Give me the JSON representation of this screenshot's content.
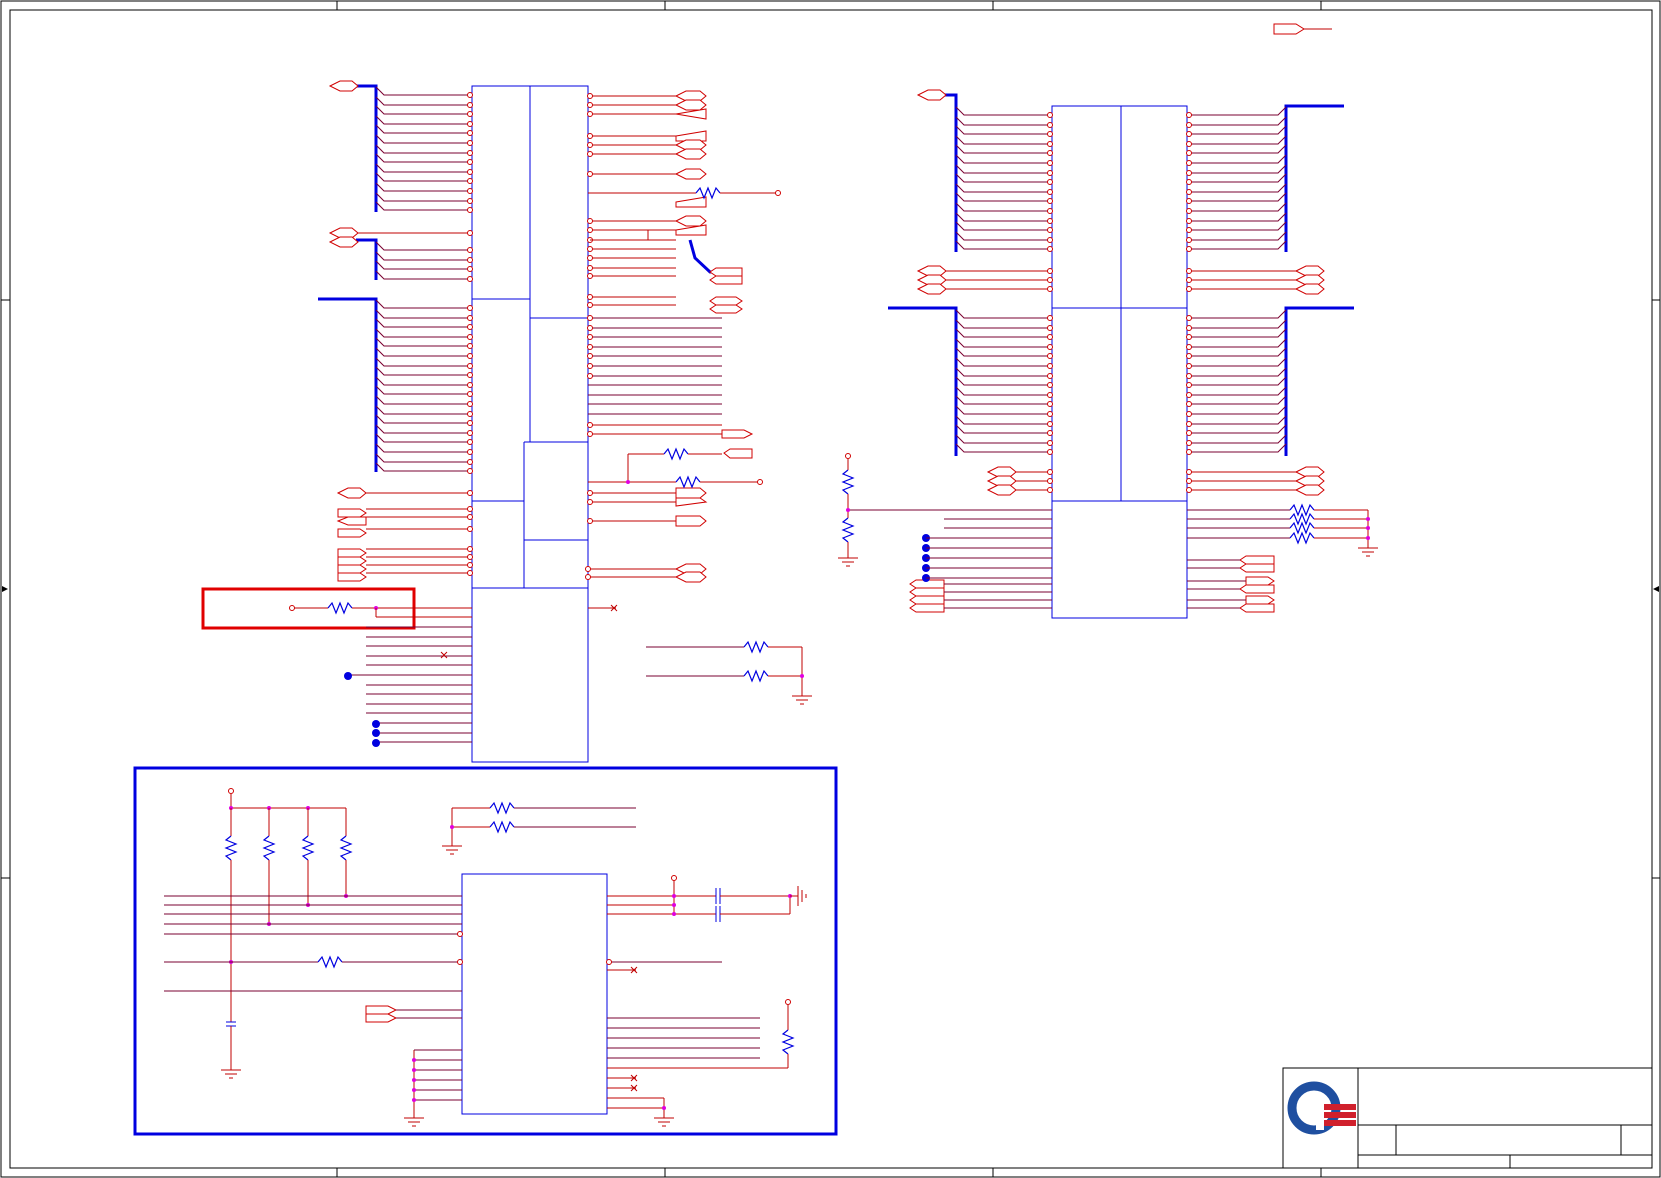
{
  "colors": {
    "wire": "#c00000",
    "bus": "#0000e0",
    "part_outline": "#0000e0",
    "highlight_red": "#e00000",
    "highlight_blue": "#0000e0",
    "junction": "#e000e0",
    "frame": "#000000",
    "logo_blue": "#1f4fa0",
    "logo_red": "#d0202c"
  },
  "icons": {
    "logo": "company-logo-icon",
    "resistor": "resistor-icon",
    "capacitor": "capacitor-icon",
    "ground": "ground-icon",
    "offpage_port": "offpage-connector-icon"
  }
}
